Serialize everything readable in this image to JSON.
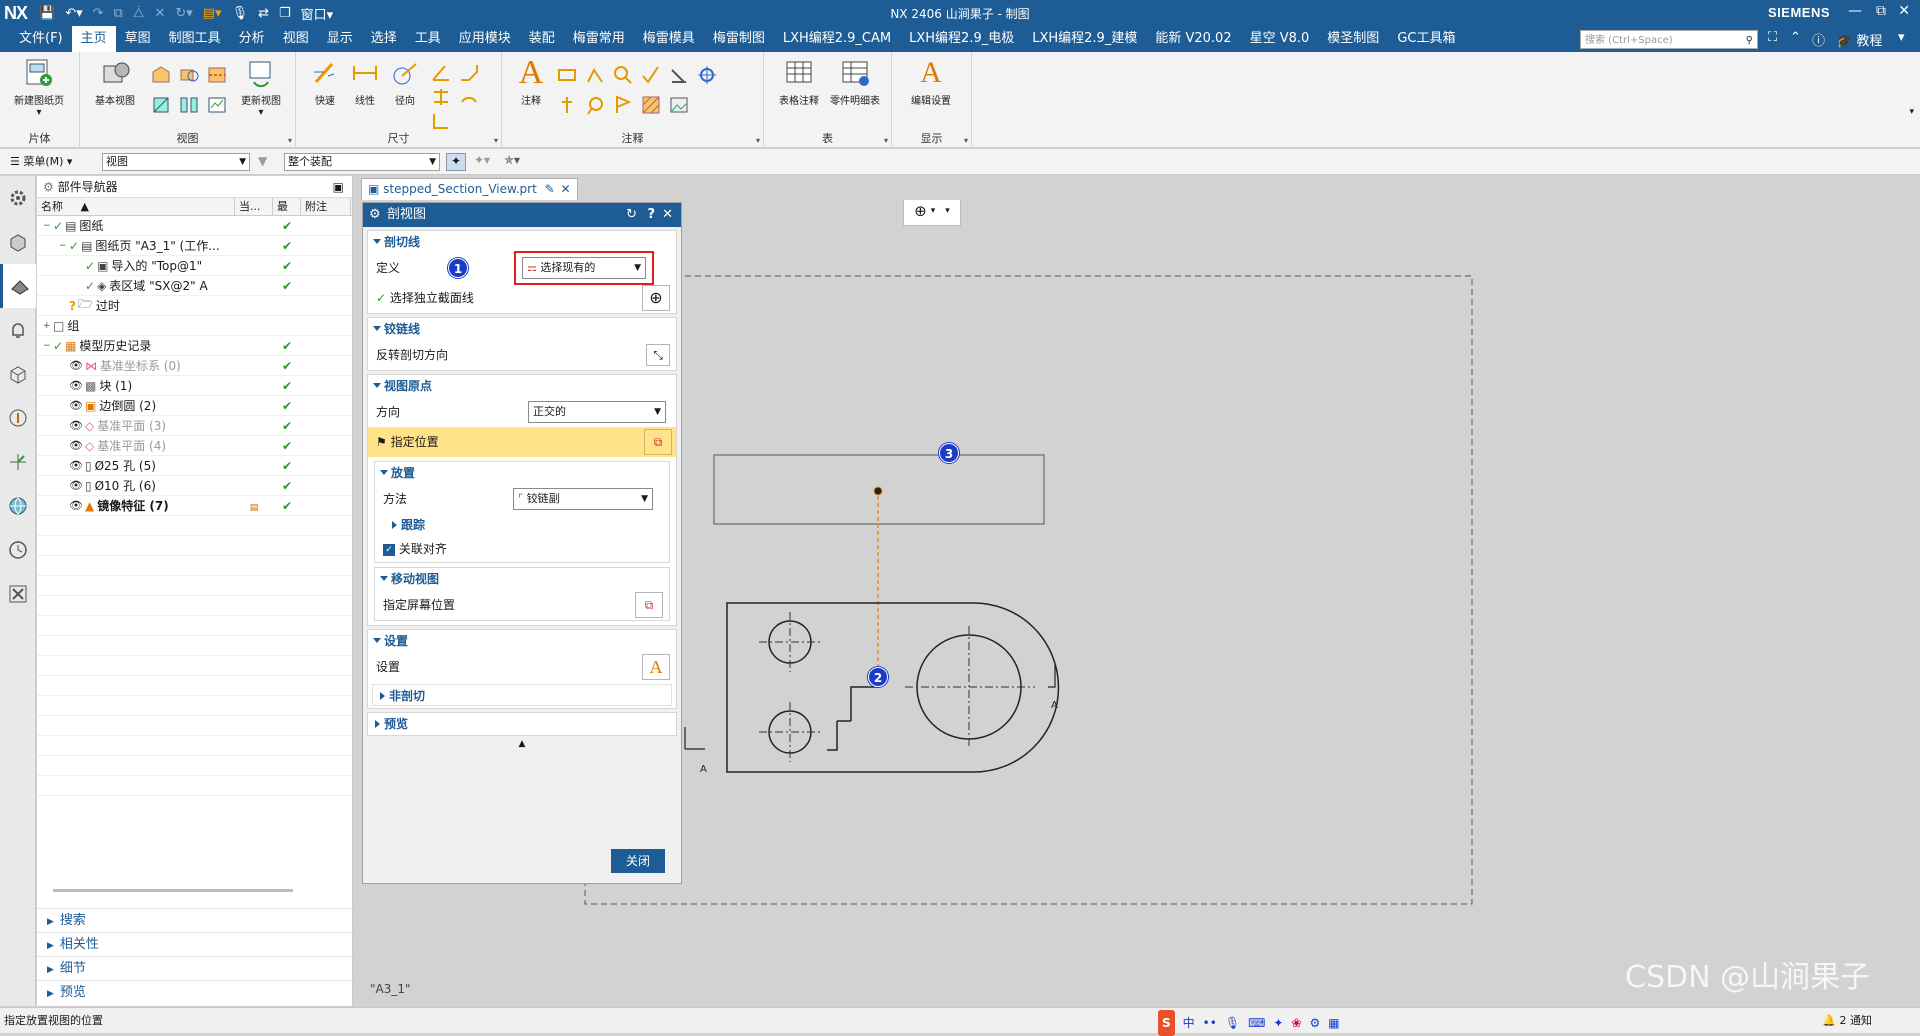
{
  "titlebar": {
    "logo": "NX",
    "window_menu": "窗口",
    "title": "NX 2406 山涧果子 - 制图",
    "brand": "SIEMENS"
  },
  "menubar": {
    "items": [
      "文件(F)",
      "主页",
      "草图",
      "制图工具",
      "分析",
      "视图",
      "显示",
      "选择",
      "工具",
      "应用模块",
      "装配",
      "梅雷常用",
      "梅雷模具",
      "梅雷制图",
      "LXH编程2.9_CAM",
      "LXH编程2.9_电极",
      "LXH编程2.9_建模",
      "能新 V20.02",
      "星空 V8.0",
      "模圣制图",
      "GC工具箱"
    ],
    "active": "主页",
    "search_placeholder": "搜索 (Ctrl+Space)",
    "tutorial": "教程"
  },
  "ribbon": {
    "groups": [
      {
        "label": "片体",
        "buttons": [
          "新建图纸页"
        ]
      },
      {
        "label": "视图",
        "buttons": [
          "基本视图",
          "更新视图"
        ]
      },
      {
        "label": "尺寸",
        "buttons": [
          "快速",
          "线性",
          "径向"
        ]
      },
      {
        "label": "注释",
        "buttons": [
          "注释"
        ]
      },
      {
        "label": "表",
        "buttons": [
          "表格注释",
          "零件明细表"
        ]
      },
      {
        "label": "显示",
        "buttons": [
          "编辑设置"
        ]
      }
    ]
  },
  "toolrow": {
    "menu": "菜单(M)",
    "filter1": "视图",
    "filter2": "整个装配"
  },
  "navigator": {
    "title": "部件导航器",
    "columns": [
      "名称",
      "当...",
      "最",
      "附注"
    ],
    "rows": [
      {
        "label": "图纸",
        "indent": 0,
        "icon": "sheet-icon",
        "check": "✔"
      },
      {
        "label": "图纸页 \"A3_1\" (工作...",
        "indent": 1,
        "icon": "sheet-page-icon",
        "check": "✔"
      },
      {
        "label": "导入的 \"Top@1\"",
        "indent": 2,
        "icon": "view-icon",
        "check": "✔"
      },
      {
        "label": "表区域 \"SX@2\" A",
        "indent": 2,
        "icon": "section-view-icon",
        "check": "✔"
      },
      {
        "label": "过时",
        "indent": 1,
        "icon": "folder-icon",
        "check": ""
      },
      {
        "label": "组",
        "indent": 0,
        "icon": "group-icon",
        "check": ""
      },
      {
        "label": "模型历史记录",
        "indent": 0,
        "icon": "history-icon",
        "check": "✔"
      },
      {
        "label": "基准坐标系 (0)",
        "indent": 1,
        "icon": "datum-csys-icon",
        "check": "✔",
        "grey": true
      },
      {
        "label": "块 (1)",
        "indent": 1,
        "icon": "block-icon",
        "check": "✔"
      },
      {
        "label": "边倒圆 (2)",
        "indent": 1,
        "icon": "blend-icon",
        "check": "✔"
      },
      {
        "label": "基准平面 (3)",
        "indent": 1,
        "icon": "datum-plane-icon",
        "check": "✔",
        "grey": true
      },
      {
        "label": "基准平面 (4)",
        "indent": 1,
        "icon": "datum-plane-icon",
        "check": "✔",
        "grey": true
      },
      {
        "label": "Ø25 孔 (5)",
        "indent": 1,
        "icon": "hole-icon",
        "check": "✔"
      },
      {
        "label": "Ø10 孔 (6)",
        "indent": 1,
        "icon": "hole-icon",
        "check": "✔"
      },
      {
        "label": "镜像特征 (7)",
        "indent": 1,
        "icon": "mirror-icon",
        "check": "✔",
        "bold": true
      }
    ],
    "sections": [
      "搜索",
      "相关性",
      "细节",
      "预览"
    ]
  },
  "graphics": {
    "tab_label": "stepped_Section_View.prt",
    "sheet_label": "\"A3_1\"",
    "section_letter": "A",
    "marker3": "3",
    "marker2": "2"
  },
  "dialog": {
    "title": "剖视图",
    "s1_title": "剖切线",
    "define_label": "定义",
    "define_value": "选择现有的",
    "marker1": "1",
    "select_line_label": "选择独立截面线",
    "s2_title": "铰链线",
    "reverse_label": "反转剖切方向",
    "s3_title": "视图原点",
    "orientation_label": "方向",
    "orientation_value": "正交的",
    "specify_location": "指定位置",
    "s4_title": "放置",
    "method_label": "方法",
    "method_value": "铰链副",
    "track_label": "跟踪",
    "assoc_align": "关联对齐",
    "s5_title": "移动视图",
    "screen_pos": "指定屏幕位置",
    "s6_title": "设置",
    "settings_label": "设置",
    "non_section": "非剖切",
    "s7_title": "预览",
    "close_btn": "关闭"
  },
  "statusbar": {
    "prompt": "指定放置视图的位置",
    "notify": "2 通知",
    "watermark": "CSDN @山涧果子"
  }
}
